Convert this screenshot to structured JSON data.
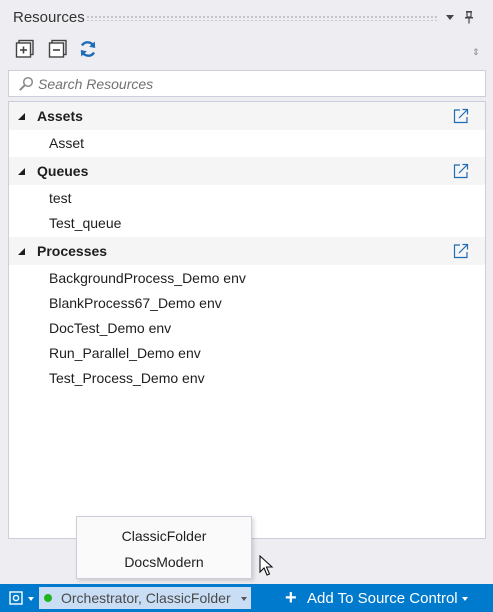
{
  "panel": {
    "title": "Resources",
    "icons": {
      "dropdown": "chevron-down-icon",
      "pin": "pin-icon"
    }
  },
  "toolbar": {
    "buttons": [
      {
        "name": "expand-all",
        "icon": "plus-box-icon"
      },
      {
        "name": "collapse-all",
        "icon": "minus-box-icon"
      },
      {
        "name": "refresh",
        "icon": "refresh-icon"
      }
    ]
  },
  "search": {
    "placeholder": "Search Resources",
    "value": "",
    "icon": "search-icon"
  },
  "tree": {
    "groups": [
      {
        "label": "Assets",
        "expanded": true,
        "items": [
          "Asset"
        ]
      },
      {
        "label": "Queues",
        "expanded": true,
        "items": [
          "test",
          "Test_queue"
        ]
      },
      {
        "label": "Processes",
        "expanded": true,
        "items": [
          "BackgroundProcess_Demo env",
          "BlankProcess67_Demo env",
          "DocTest_Demo env",
          "Run_Parallel_Demo env",
          "Test_Process_Demo env"
        ]
      }
    ]
  },
  "folder_dropdown": {
    "options": [
      "ClassicFolder",
      "DocsModern"
    ]
  },
  "statusbar": {
    "orchestrator_label": "Orchestrator, ClassicFolder",
    "connection_status": "connected",
    "add_to_source_label": "Add To Source Control",
    "plus_glyph": "+"
  },
  "colors": {
    "statusbar_bg": "#007acc",
    "panel_bg": "#eeeef2",
    "status_dot": "#1fb51f",
    "orchestrator_bg": "#c9def5",
    "icon_blue": "#1e6bb8"
  }
}
